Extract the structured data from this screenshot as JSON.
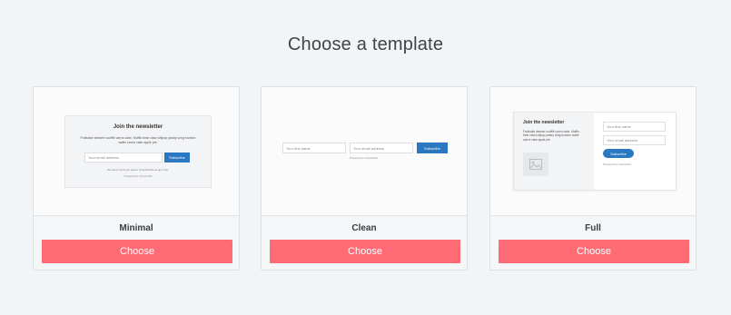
{
  "page_title": "Choose a template",
  "templates": [
    {
      "name": "Minimal",
      "choose_label": "Choose",
      "preview": {
        "heading": "Join the newsletter",
        "description": "Fruitcake dessert soufflé carrot cake. Muffin bear claw lollipop pastry icing bonbon wafer carrot cake apple pie.",
        "email_placeholder": "Your email address",
        "button": "Subscribe",
        "note": "We won't send you spam. Unsubscribe at any time.",
        "powered": "Powered by ConvertKit"
      }
    },
    {
      "name": "Clean",
      "choose_label": "Choose",
      "preview": {
        "first_name_placeholder": "Your first name",
        "email_placeholder": "Your email address",
        "button": "Subscribe",
        "powered": "Powered by ConvertKit"
      }
    },
    {
      "name": "Full",
      "choose_label": "Choose",
      "preview": {
        "heading": "Join the newsletter",
        "description": "Fruitcake dessert soufflé carrot cake. Muffin bear claw lollipop pastry icing bonbon wafer carrot cake apple pie.",
        "first_name_placeholder": "Your first name",
        "email_placeholder": "Your email address",
        "button": "Subscribe",
        "powered": "Powered by ConvertKit",
        "image_icon": "image-placeholder-icon"
      }
    }
  ],
  "colors": {
    "background": "#f2f5f8",
    "choose_button": "#ff6b75",
    "subscribe_button": "#2a78c2"
  }
}
